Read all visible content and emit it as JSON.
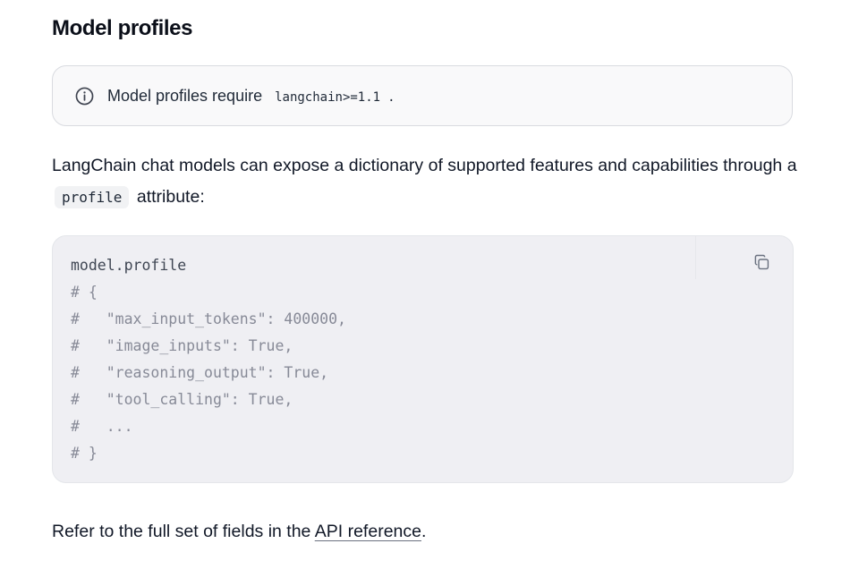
{
  "section": {
    "title": "Model profiles"
  },
  "callout": {
    "icon": "info-icon",
    "text": "Model profiles require",
    "code": "langchain>=1.1",
    "suffix": "."
  },
  "paragraph": {
    "text_before": "LangChain chat models can expose a dictionary of supported features and capabilities through a",
    "inline_code": "profile",
    "text_after": "attribute:"
  },
  "code_block": {
    "copy_icon": "copy-icon",
    "lines": [
      {
        "text": "model.profile",
        "kind": "code"
      },
      {
        "text": "# {",
        "kind": "comment"
      },
      {
        "text": "#   \"max_input_tokens\": 400000,",
        "kind": "comment"
      },
      {
        "text": "#   \"image_inputs\": True,",
        "kind": "comment"
      },
      {
        "text": "#   \"reasoning_output\": True,",
        "kind": "comment"
      },
      {
        "text": "#   \"tool_calling\": True,",
        "kind": "comment"
      },
      {
        "text": "#   ...",
        "kind": "comment"
      },
      {
        "text": "# }",
        "kind": "comment"
      }
    ]
  },
  "footer": {
    "text_before": "Refer to the full set of fields in the",
    "link_text": "API reference",
    "text_after": "."
  }
}
